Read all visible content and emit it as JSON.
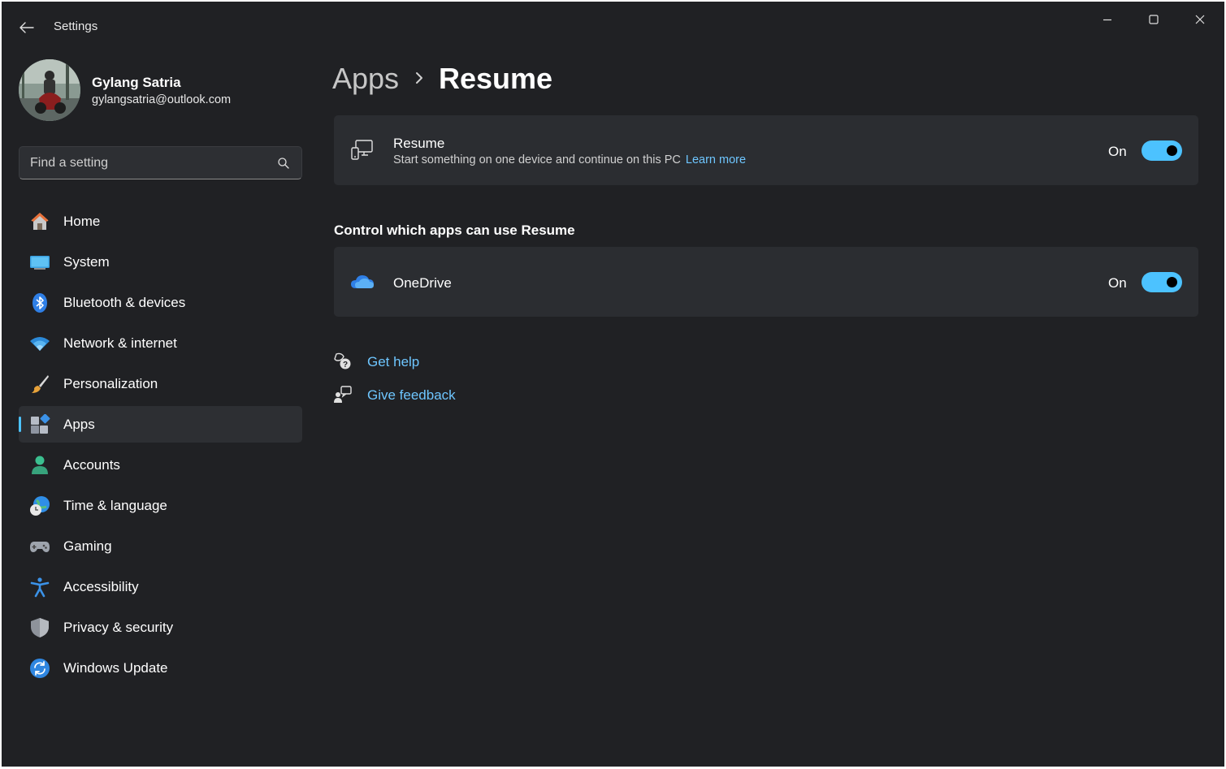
{
  "window": {
    "title": "Settings"
  },
  "profile": {
    "name": "Gylang Satria",
    "email": "gylangsatria@outlook.com"
  },
  "search": {
    "placeholder": "Find a setting",
    "value": ""
  },
  "sidebar": {
    "items": [
      {
        "label": "Home",
        "icon": "home-icon"
      },
      {
        "label": "System",
        "icon": "system-icon"
      },
      {
        "label": "Bluetooth & devices",
        "icon": "bluetooth-icon"
      },
      {
        "label": "Network & internet",
        "icon": "wifi-icon"
      },
      {
        "label": "Personalization",
        "icon": "brush-icon"
      },
      {
        "label": "Apps",
        "icon": "apps-icon",
        "selected": true
      },
      {
        "label": "Accounts",
        "icon": "person-icon"
      },
      {
        "label": "Time & language",
        "icon": "globe-clock-icon"
      },
      {
        "label": "Gaming",
        "icon": "gamepad-icon"
      },
      {
        "label": "Accessibility",
        "icon": "accessibility-icon"
      },
      {
        "label": "Privacy & security",
        "icon": "shield-icon"
      },
      {
        "label": "Windows Update",
        "icon": "update-icon"
      }
    ]
  },
  "breadcrumb": {
    "parent": "Apps",
    "current": "Resume"
  },
  "resume_card": {
    "title": "Resume",
    "description": "Start something on one device and continue on this PC",
    "link": "Learn more",
    "toggle_state": "On",
    "toggle_on": true
  },
  "apps_section": {
    "heading": "Control which apps can use Resume",
    "apps": [
      {
        "name": "OneDrive",
        "toggle_state": "On",
        "toggle_on": true,
        "icon": "onedrive-icon"
      }
    ]
  },
  "help": {
    "get_help": "Get help",
    "give_feedback": "Give feedback"
  },
  "colors": {
    "background": "#202124",
    "card": "#2b2d31",
    "accent": "#4cc2ff",
    "link": "#6ec6ff"
  }
}
